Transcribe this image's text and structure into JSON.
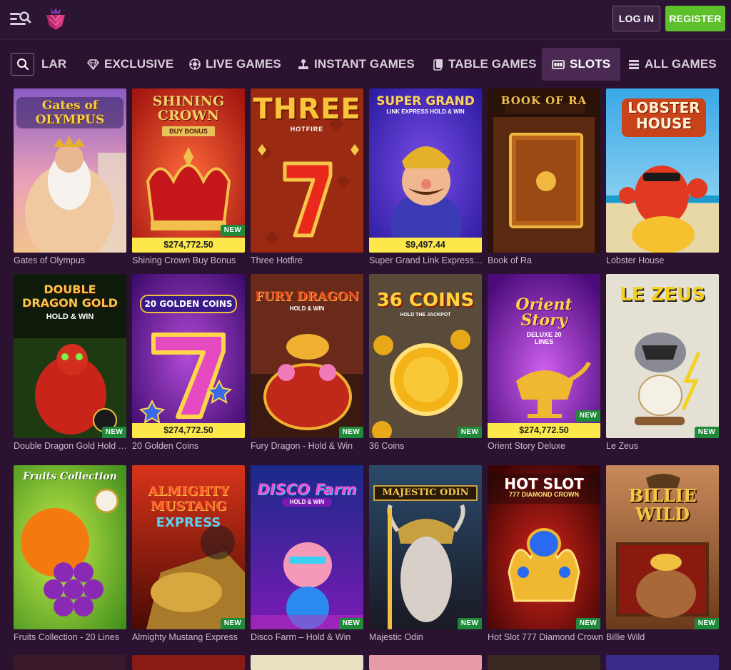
{
  "header": {
    "login_label": "LOG IN",
    "register_label": "REGISTER"
  },
  "nav": {
    "tabs": [
      {
        "label": "LAR",
        "icon": "none"
      },
      {
        "label": "EXCLUSIVE",
        "icon": "diamond-icon"
      },
      {
        "label": "LIVE GAMES",
        "icon": "chip-icon"
      },
      {
        "label": "INSTANT GAMES",
        "icon": "joystick-icon"
      },
      {
        "label": "TABLE GAMES",
        "icon": "cards-icon"
      },
      {
        "label": "SLOTS",
        "icon": "slot-machine-icon",
        "active": true
      },
      {
        "label": "ALL GAMES",
        "icon": "stack-icon"
      }
    ]
  },
  "games": [
    {
      "name": "Gates of Olympus",
      "title_art": "Gates of OLYMPUS",
      "jackpot": "",
      "new": false
    },
    {
      "name": "Shining Crown Buy Bonus",
      "title_art": "SHINING CROWN",
      "subtitle_art": "BUY BONUS",
      "jackpot": "$274,772.50",
      "new": true
    },
    {
      "name": "Three Hotfire",
      "title_art": "THREE",
      "subtitle_art": "HOTFIRE",
      "jackpot": "",
      "new": false
    },
    {
      "name": "Super Grand Link Express: Hold & Win",
      "title_art": "SUPER GRAND",
      "subtitle_art": "LINK EXPRESS HOLD & WIN",
      "jackpot": "$9,497.44",
      "new": false
    },
    {
      "name": "Book of Ra",
      "title_art": "BOOK OF RA",
      "jackpot": "",
      "new": false
    },
    {
      "name": "Lobster House",
      "title_art": "LOBSTER HOUSE",
      "jackpot": "",
      "new": false
    },
    {
      "name": "Double Dragon Gold Hold & Win",
      "title_art": "DOUBLE DRAGON GOLD",
      "subtitle_art": "HOLD & WIN",
      "jackpot": "",
      "new": true
    },
    {
      "name": "20 Golden Coins",
      "title_art": "20 GOLDEN COINS",
      "jackpot": "$274,772.50",
      "new": false
    },
    {
      "name": "Fury Dragon - Hold & Win",
      "title_art": "FURY DRAGON",
      "subtitle_art": "HOLD & WIN",
      "jackpot": "",
      "new": true
    },
    {
      "name": "36 Coins",
      "title_art": "36 COINS",
      "subtitle_art": "HOLD THE JACKPOT",
      "jackpot": "",
      "new": true
    },
    {
      "name": "Orient Story Deluxe",
      "title_art": "Orient Story",
      "subtitle_art": "DELUXE 20 LINES",
      "jackpot": "$274,772.50",
      "new": true
    },
    {
      "name": "Le Zeus",
      "title_art": "LE ZEUS",
      "jackpot": "",
      "new": true
    },
    {
      "name": "Fruits Collection - 20 Lines",
      "title_art": "Fruits Collection",
      "jackpot": "",
      "new": false
    },
    {
      "name": "Almighty Mustang Express",
      "title_art": "ALMIGHTY MUSTANG",
      "subtitle_art": "EXPRESS",
      "jackpot": "",
      "new": true
    },
    {
      "name": "Disco Farm – Hold & Win",
      "title_art": "DISCO Farm",
      "subtitle_art": "HOLD & WIN",
      "jackpot": "",
      "new": true
    },
    {
      "name": "Majestic Odin",
      "title_art": "MAJESTIC ODIN",
      "jackpot": "",
      "new": true
    },
    {
      "name": "Hot Slot 777 Diamond Crown",
      "title_art": "HOT SLOT",
      "subtitle_art": "777 DIAMOND CROWN",
      "jackpot": "",
      "new": true
    },
    {
      "name": "Billie Wild",
      "title_art": "BILLIE WILD",
      "jackpot": "",
      "new": true
    }
  ],
  "new_badge_label": "NEW",
  "colors": {
    "background": "#2a1230",
    "jackpot_bg": "#fde84c",
    "new_badge": "#1e8a3a",
    "register": "#5dbf2a",
    "active_tab": "#4a2a52"
  }
}
